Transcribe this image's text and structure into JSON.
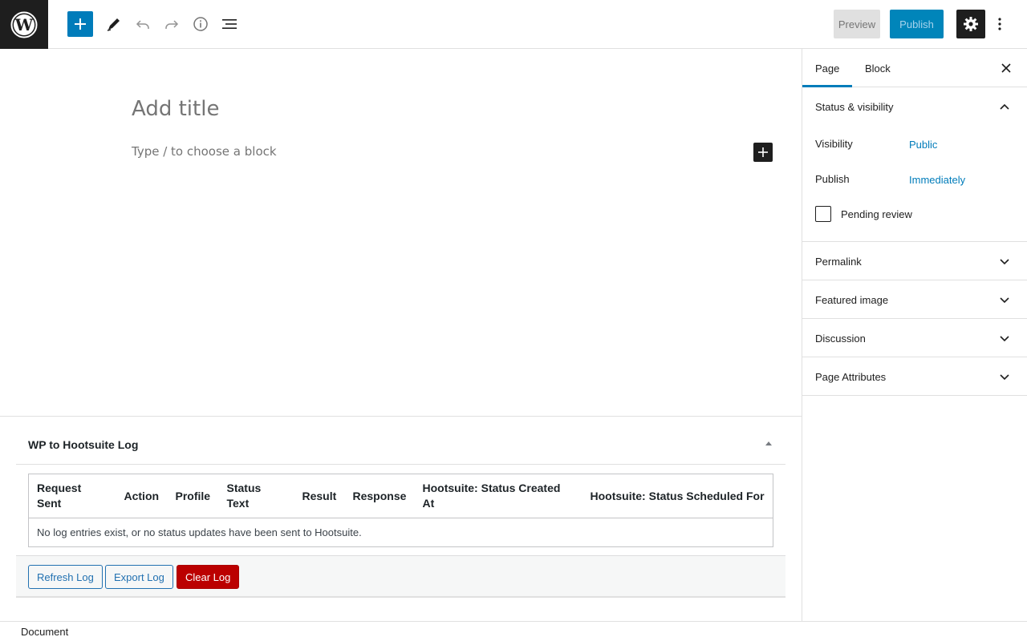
{
  "topbar": {
    "logo": "wordpress-logo",
    "icons": [
      "plus-icon",
      "pencil-icon",
      "undo-icon",
      "redo-icon",
      "info-icon",
      "list-view-icon"
    ],
    "preview_label": "Preview",
    "publish_label": "Publish",
    "settings_icon": "gear-icon",
    "more_icon": "kebab-icon"
  },
  "editor": {
    "title_placeholder": "Add title",
    "block_placeholder": "Type / to choose a block"
  },
  "metabox": {
    "title": "WP to Hootsuite Log",
    "columns": [
      "Request Sent",
      "Action",
      "Profile",
      "Status Text",
      "Result",
      "Response",
      "Hootsuite: Status Created At",
      "Hootsuite: Status Scheduled For"
    ],
    "empty_message": "No log entries exist, or no status updates have been sent to Hootsuite.",
    "buttons": {
      "refresh": "Refresh Log",
      "export": "Export Log",
      "clear": "Clear Log"
    }
  },
  "footer": {
    "breadcrumb": "Document"
  },
  "sidebar": {
    "tabs": [
      {
        "label": "Page",
        "active": true
      },
      {
        "label": "Block",
        "active": false
      }
    ],
    "status_panel": {
      "title": "Status & visibility",
      "visibility_label": "Visibility",
      "visibility_value": "Public",
      "publish_label": "Publish",
      "publish_value": "Immediately",
      "pending_label": "Pending review",
      "pending_checked": false
    },
    "panels": [
      {
        "title": "Permalink"
      },
      {
        "title": "Featured image"
      },
      {
        "title": "Discussion"
      },
      {
        "title": "Page Attributes"
      }
    ]
  },
  "colors": {
    "accent": "#007cba",
    "danger": "#bb0000",
    "dark": "#1e1e1e"
  }
}
